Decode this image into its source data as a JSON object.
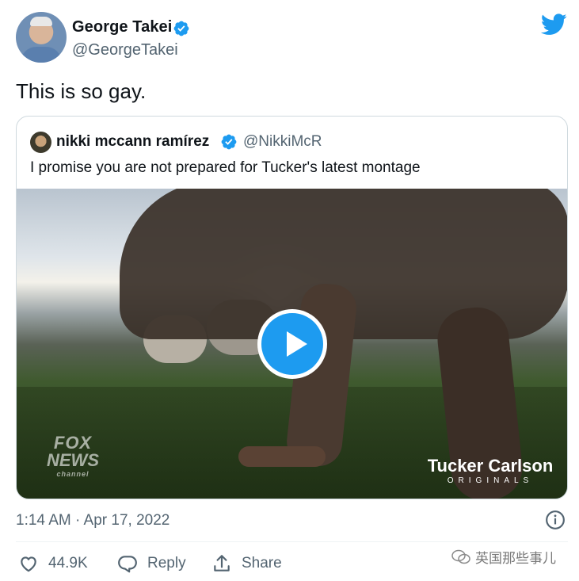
{
  "author": {
    "display_name": "George Takei",
    "handle": "@GeorgeTakei",
    "avatar_icon": "avatar-photo"
  },
  "tweet": {
    "text": "This is so gay.",
    "timestamp": "1:14 AM · Apr 17, 2022"
  },
  "quoted_tweet": {
    "display_name": "nikki mccann ramírez",
    "handle": "@NikkiMcR",
    "text": "I promise you are not prepared for Tucker's latest montage",
    "video": {
      "fox_logo": [
        "FOX",
        "NEWS",
        "channel"
      ],
      "show_logo": {
        "title": "Tucker Carlson",
        "subtitle": "ORIGINALS"
      }
    }
  },
  "actions": {
    "like_count": "44.9K",
    "reply_label": "Reply",
    "share_label": "Share"
  },
  "watermark": {
    "text": "英国那些事儿"
  },
  "colors": {
    "brand_blue": "#1d9bf0",
    "secondary_text": "#536471",
    "border": "#cfd9de"
  }
}
